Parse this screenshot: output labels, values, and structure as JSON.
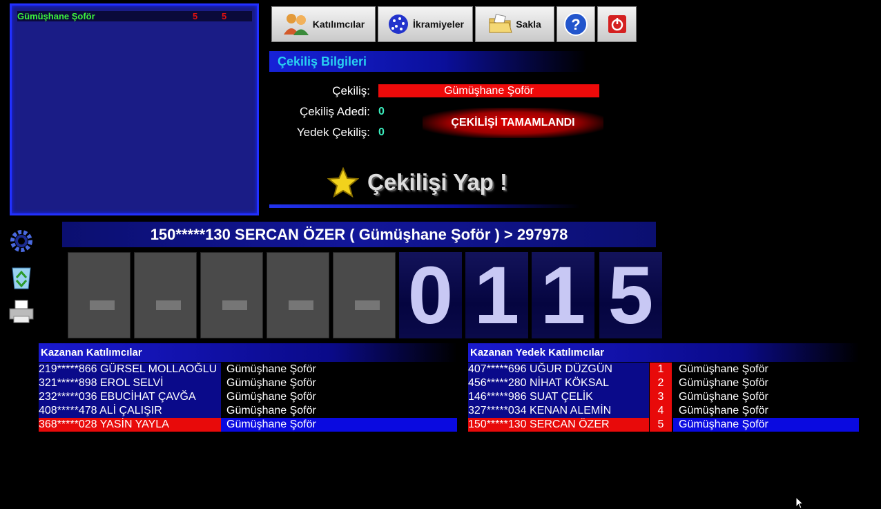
{
  "draw_list": {
    "items": [
      {
        "name": "Gümüşhane Şoför",
        "col1": "5",
        "col2": "5"
      }
    ]
  },
  "toolbar": {
    "participants_label": "Katılımcılar",
    "prizes_label": "İkramiyeler",
    "save_label": "Sakla",
    "help_icon": "question-icon",
    "power_icon": "power-icon"
  },
  "info": {
    "title": "Çekiliş Bilgileri",
    "draw_label": "Çekiliş:",
    "draw_value": "Gümüşhane Şoför",
    "count_label": "Çekiliş Adedi:",
    "count_value": "0",
    "backup_label": "Yedek Çekiliş:",
    "backup_value": "0",
    "status": "ÇEKİLİŞİ  TAMAMLANDI",
    "make_draw_label": "Çekilişi Yap !"
  },
  "winner_banner": "150*****130 SERCAN ÖZER   ( Gümüşhane Şoför )   > 297978",
  "digits": [
    "-",
    "-",
    "-",
    "-",
    "-",
    "0",
    "1",
    "1",
    "5"
  ],
  "winners": {
    "title": "Kazanan Katılımcılar",
    "rows": [
      {
        "participant": "219*****866 GÜRSEL MOLLAOĞLU",
        "draw": "Gümüşhane Şoför"
      },
      {
        "participant": "321*****898 EROL SELVİ",
        "draw": "Gümüşhane Şoför"
      },
      {
        "participant": "232*****036 EBUCİHAT ÇAVĞA",
        "draw": "Gümüşhane Şoför"
      },
      {
        "participant": "408*****478 ALİ ÇALIŞIR",
        "draw": "Gümüşhane Şoför"
      },
      {
        "participant": "368*****028 YASİN YAYLA",
        "draw": "Gümüşhane Şoför"
      }
    ]
  },
  "backup_winners": {
    "title": "Kazanan Yedek Katılımcılar",
    "rows": [
      {
        "participant": "407*****696 UĞUR DÜZGÜN",
        "rank": "1",
        "draw": "Gümüşhane Şoför"
      },
      {
        "participant": "456*****280 NİHAT KÖKSAL",
        "rank": "2",
        "draw": "Gümüşhane Şoför"
      },
      {
        "participant": "146*****986 SUAT ÇELİK",
        "rank": "3",
        "draw": "Gümüşhane Şoför"
      },
      {
        "participant": "327*****034 KENAN ALEMİN",
        "rank": "4",
        "draw": "Gümüşhane Şoför"
      },
      {
        "participant": "150*****130 SERCAN ÖZER",
        "rank": "5",
        "draw": "Gümüşhane Şoför"
      }
    ]
  },
  "colors": {
    "panel_blue": "#1a1c86",
    "highlight_red": "#e80a0a",
    "highlight_blue": "#0a0ae0",
    "header_cyan": "#29d0f0",
    "value_green": "#3cf0c0"
  }
}
